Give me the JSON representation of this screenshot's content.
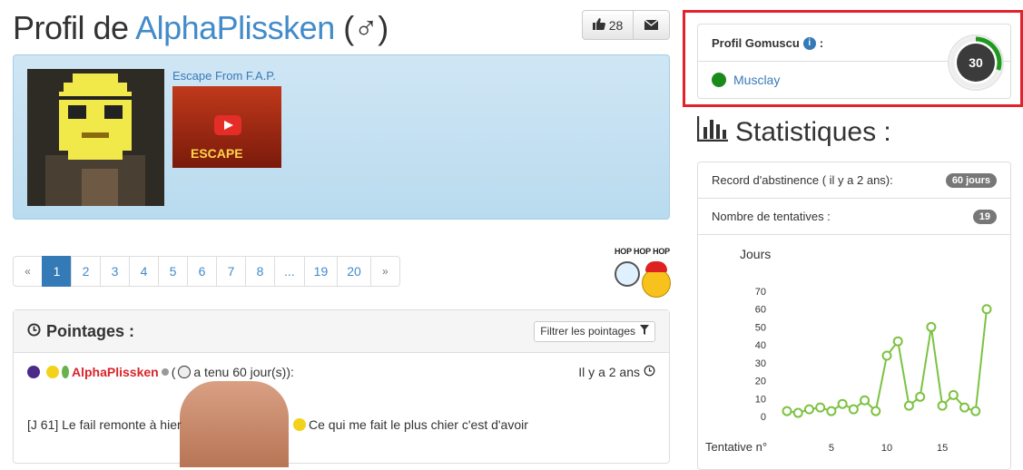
{
  "header": {
    "title_prefix": "Profil de ",
    "username": "AlphaPlissken",
    "gender_symbol": "(♂)",
    "like_count": "28"
  },
  "profile_box": {
    "signature_title": "Escape From F.A.P.",
    "signature_caption": "ESCAPE"
  },
  "pagination": {
    "pages": [
      "«",
      "1",
      "2",
      "3",
      "4",
      "5",
      "6",
      "7",
      "8",
      "...",
      "19",
      "20",
      "»"
    ],
    "active": "1"
  },
  "hop_sticker": {
    "text": "HOP HOP HOP"
  },
  "pointages": {
    "title": "Pointages :",
    "filter_label": "Filtrer les pointages",
    "entry_user": "AlphaPlissken",
    "entry_text": "a tenu 60 jour(s)):",
    "entry_paren": "(",
    "entry_date": "Il y a 2 ans",
    "entry_message": "[J 61] Le fail remonte à hier",
    "entry_message_2": "Ce qui me fait le plus chier c'est d'avoir"
  },
  "gomuscu": {
    "title": "Profil Gomuscu",
    "colon": ":",
    "link": "Musclay",
    "gauge_value": "30",
    "gauge_fraction": 0.3
  },
  "statistics": {
    "title": "Statistiques :",
    "rows": [
      {
        "label": "Record d'abstinence ( il y a 2 ans):",
        "badge": "60 jours"
      },
      {
        "label": "Nombre de tentatives :",
        "badge": "19"
      }
    ]
  },
  "chart_data": {
    "type": "line",
    "ylabel": "Jours",
    "xlabel": "Tentative n°",
    "ylim": [
      0,
      70
    ],
    "yticks": [
      0,
      10,
      20,
      30,
      40,
      50,
      60,
      70
    ],
    "xticks": [
      5,
      10,
      15
    ],
    "x": [
      1,
      2,
      3,
      4,
      5,
      6,
      7,
      8,
      9,
      10,
      11,
      12,
      13,
      14,
      15,
      16,
      17,
      18,
      19
    ],
    "values": [
      3,
      2,
      4,
      5,
      3,
      7,
      4,
      9,
      3,
      34,
      42,
      6,
      11,
      50,
      6,
      12,
      5,
      3,
      60
    ],
    "color": "#7cc242",
    "grid": false
  }
}
